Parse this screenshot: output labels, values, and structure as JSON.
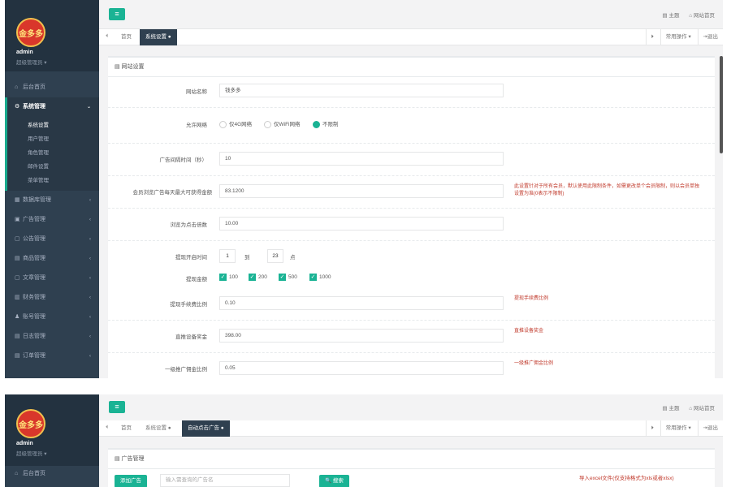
{
  "user": {
    "name": "admin",
    "role": "超级管理员 ▾",
    "logo_text": "金多多"
  },
  "topbar": {
    "theme": "▤ 主题",
    "site_home": "⌂ 网站首页"
  },
  "tabs_right": {
    "forward": "⏵",
    "ops": "常用操作 ▾",
    "logout": "⇥退出"
  },
  "sidebar": {
    "home": "后台首页",
    "system": "系统管理",
    "system_sub": [
      "系统设置",
      "用户管理",
      "角色管理",
      "邮件设置",
      "菜单管理"
    ],
    "items": [
      "数据库管理",
      "广告管理",
      "公告管理",
      "商品管理",
      "文章管理",
      "财务管理",
      "账号管理",
      "日志管理",
      "订单管理"
    ]
  },
  "panel1": {
    "tabs": {
      "back": "⏴",
      "home": "首页",
      "active": "系统设置 ●"
    },
    "card_title": "▤ 网站设置",
    "fields": {
      "site_name_label": "网站名称",
      "site_name_value": "钱多多",
      "network_label": "允许网络",
      "net_4g": "仅4G网络",
      "net_wifi": "仅WiFi网络",
      "net_any": "不限制",
      "interval_label": "广告间隔时间（秒）",
      "interval_value": "10",
      "max_gold_label": "会员浏览广告每天最大可获得金额",
      "max_gold_value": "83.1200",
      "max_gold_hint": "此设置针对于所有会员，默认使用此限制条件，如需更改单个会员限制，则以会员单独设置为准(0表示不限制)",
      "click_mult_label": "浏览为点击倍数",
      "click_mult_value": "10.00",
      "withdraw_time_label": "提现开启时间",
      "withdraw_from": "1",
      "withdraw_to_text": "到",
      "withdraw_to": "23",
      "withdraw_unit": "点",
      "withdraw_amount_label": "提现金额",
      "amt1": "100",
      "amt2": "200",
      "amt3": "500",
      "amt4": "1000",
      "fee_label": "提现手续费比例",
      "fee_value": "0.10",
      "fee_hint": "提现手续费比例",
      "bonus_label": "直推设备奖金",
      "bonus_value": "398.00",
      "bonus_hint": "直推设备奖金",
      "commission_label": "一级推广佣金比例",
      "commission_value": "0.05",
      "commission_hint": "一级推广佣金比例"
    }
  },
  "panel2": {
    "tabs": {
      "back": "⏴",
      "home": "首页",
      "settings": "系统设置 ●",
      "active": "自动点击广告 ●"
    },
    "card_title": "▤ 广告管理",
    "add_button": "添加广告",
    "search_placeholder": "输入需查询的广告名",
    "search_button": "🔍 搜索",
    "import_hint": "导入excel文件(仅支持格式为xls或者xlsx)"
  },
  "colors": {
    "sidebar": "#2f4050",
    "accent": "#1ab394",
    "hint": "#c0392b"
  }
}
